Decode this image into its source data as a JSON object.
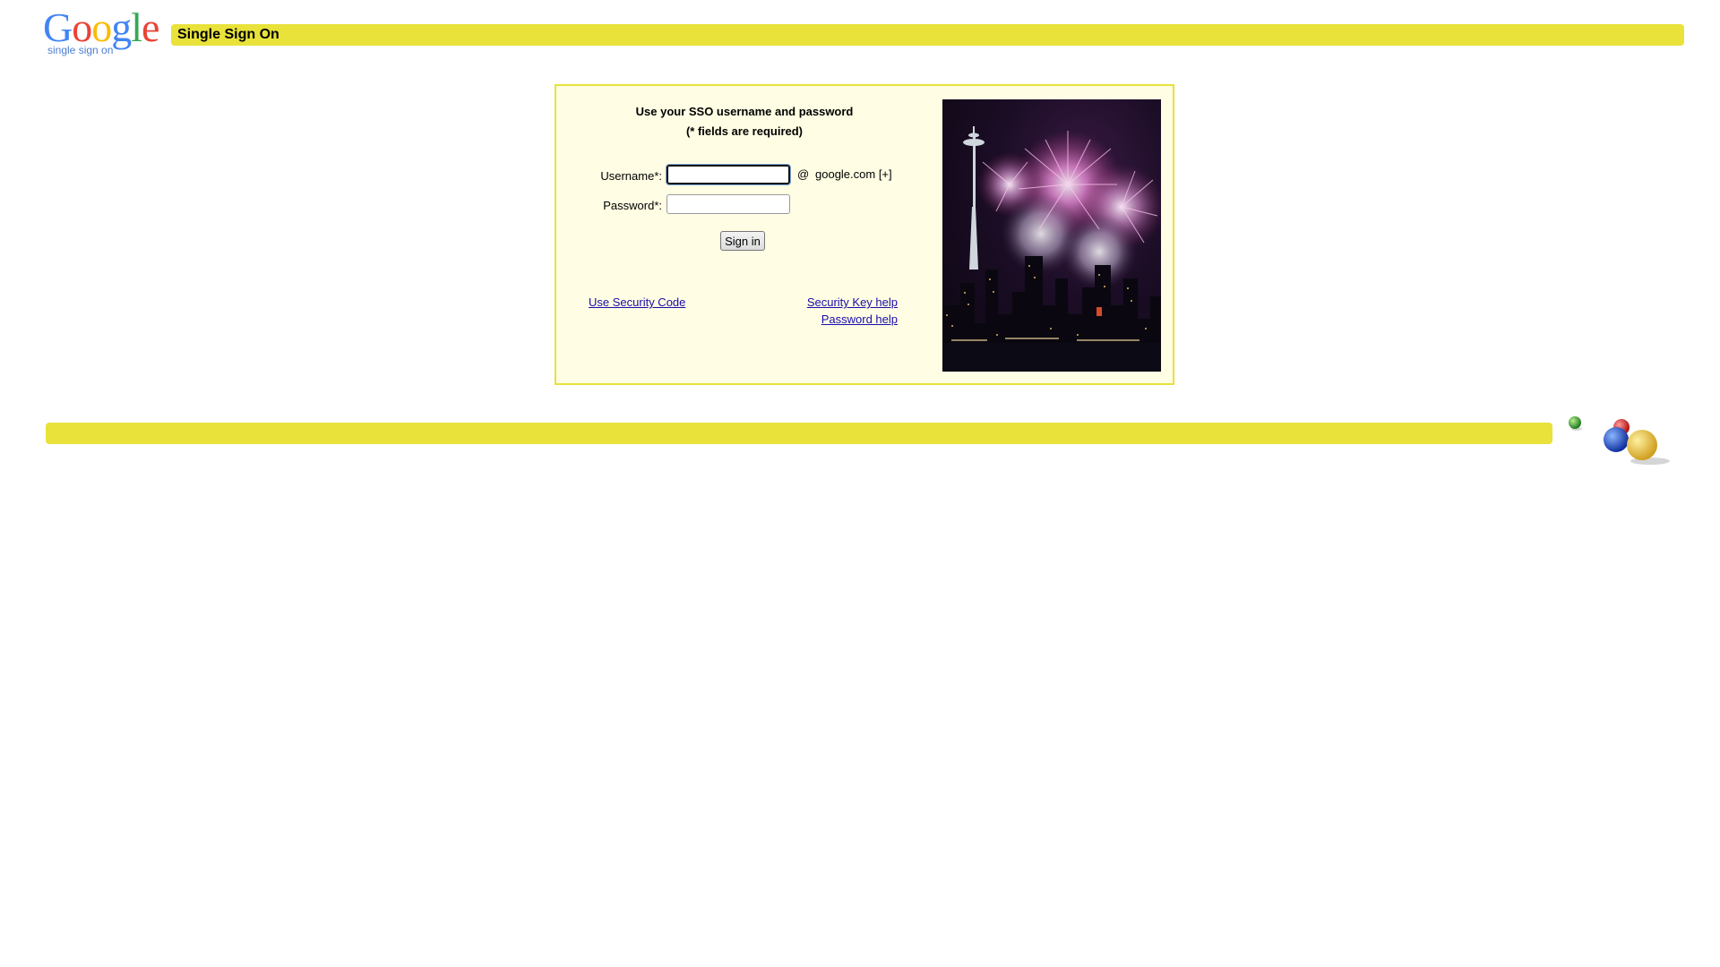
{
  "header": {
    "logo": {
      "letters": [
        "G",
        "o",
        "o",
        "g",
        "l",
        "e"
      ],
      "letter_colors": [
        "#4285f4",
        "#ea4335",
        "#fbbc05",
        "#4285f4",
        "#34a853",
        "#ea4335"
      ],
      "subtext": "single sign on"
    },
    "title": "Single Sign On"
  },
  "login": {
    "heading_line1": "Use your SSO username and password",
    "heading_line2": "(* fields are required)",
    "username_label": "Username*:",
    "username_value": "",
    "at_sign": "@",
    "domain": "google.com [+]",
    "password_label": "Password*:",
    "password_value": "",
    "signin_label": "Sign in",
    "links": {
      "security_code": "Use Security Code",
      "security_key_help": "Security Key help",
      "password_help": "Password help"
    }
  },
  "photo": {
    "subject": "fireworks over city skyline with space needle"
  },
  "colors": {
    "accent_yellow": "#e8e23a",
    "panel_background": "#fffde3",
    "link_blue": "#1a0dab",
    "logo_subtext_blue": "#4a7ed6"
  },
  "icons": {
    "footer_decoration": "google-balls-icon"
  }
}
